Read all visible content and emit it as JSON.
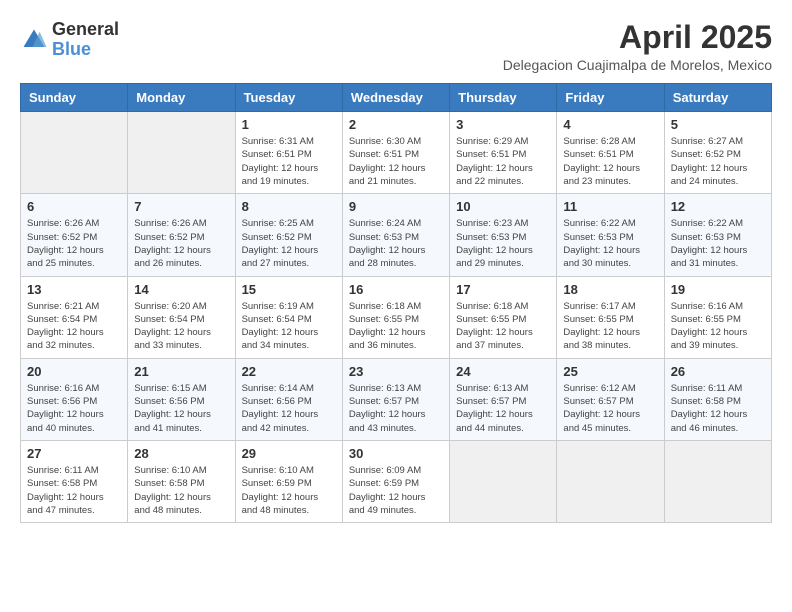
{
  "header": {
    "logo": {
      "general": "General",
      "blue": "Blue"
    },
    "title": "April 2025",
    "subtitle": "Delegacion Cuajimalpa de Morelos, Mexico"
  },
  "calendar": {
    "days_of_week": [
      "Sunday",
      "Monday",
      "Tuesday",
      "Wednesday",
      "Thursday",
      "Friday",
      "Saturday"
    ],
    "weeks": [
      [
        {
          "day": "",
          "info": ""
        },
        {
          "day": "",
          "info": ""
        },
        {
          "day": "1",
          "info": "Sunrise: 6:31 AM\nSunset: 6:51 PM\nDaylight: 12 hours and 19 minutes."
        },
        {
          "day": "2",
          "info": "Sunrise: 6:30 AM\nSunset: 6:51 PM\nDaylight: 12 hours and 21 minutes."
        },
        {
          "day": "3",
          "info": "Sunrise: 6:29 AM\nSunset: 6:51 PM\nDaylight: 12 hours and 22 minutes."
        },
        {
          "day": "4",
          "info": "Sunrise: 6:28 AM\nSunset: 6:51 PM\nDaylight: 12 hours and 23 minutes."
        },
        {
          "day": "5",
          "info": "Sunrise: 6:27 AM\nSunset: 6:52 PM\nDaylight: 12 hours and 24 minutes."
        }
      ],
      [
        {
          "day": "6",
          "info": "Sunrise: 6:26 AM\nSunset: 6:52 PM\nDaylight: 12 hours and 25 minutes."
        },
        {
          "day": "7",
          "info": "Sunrise: 6:26 AM\nSunset: 6:52 PM\nDaylight: 12 hours and 26 minutes."
        },
        {
          "day": "8",
          "info": "Sunrise: 6:25 AM\nSunset: 6:52 PM\nDaylight: 12 hours and 27 minutes."
        },
        {
          "day": "9",
          "info": "Sunrise: 6:24 AM\nSunset: 6:53 PM\nDaylight: 12 hours and 28 minutes."
        },
        {
          "day": "10",
          "info": "Sunrise: 6:23 AM\nSunset: 6:53 PM\nDaylight: 12 hours and 29 minutes."
        },
        {
          "day": "11",
          "info": "Sunrise: 6:22 AM\nSunset: 6:53 PM\nDaylight: 12 hours and 30 minutes."
        },
        {
          "day": "12",
          "info": "Sunrise: 6:22 AM\nSunset: 6:53 PM\nDaylight: 12 hours and 31 minutes."
        }
      ],
      [
        {
          "day": "13",
          "info": "Sunrise: 6:21 AM\nSunset: 6:54 PM\nDaylight: 12 hours and 32 minutes."
        },
        {
          "day": "14",
          "info": "Sunrise: 6:20 AM\nSunset: 6:54 PM\nDaylight: 12 hours and 33 minutes."
        },
        {
          "day": "15",
          "info": "Sunrise: 6:19 AM\nSunset: 6:54 PM\nDaylight: 12 hours and 34 minutes."
        },
        {
          "day": "16",
          "info": "Sunrise: 6:18 AM\nSunset: 6:55 PM\nDaylight: 12 hours and 36 minutes."
        },
        {
          "day": "17",
          "info": "Sunrise: 6:18 AM\nSunset: 6:55 PM\nDaylight: 12 hours and 37 minutes."
        },
        {
          "day": "18",
          "info": "Sunrise: 6:17 AM\nSunset: 6:55 PM\nDaylight: 12 hours and 38 minutes."
        },
        {
          "day": "19",
          "info": "Sunrise: 6:16 AM\nSunset: 6:55 PM\nDaylight: 12 hours and 39 minutes."
        }
      ],
      [
        {
          "day": "20",
          "info": "Sunrise: 6:16 AM\nSunset: 6:56 PM\nDaylight: 12 hours and 40 minutes."
        },
        {
          "day": "21",
          "info": "Sunrise: 6:15 AM\nSunset: 6:56 PM\nDaylight: 12 hours and 41 minutes."
        },
        {
          "day": "22",
          "info": "Sunrise: 6:14 AM\nSunset: 6:56 PM\nDaylight: 12 hours and 42 minutes."
        },
        {
          "day": "23",
          "info": "Sunrise: 6:13 AM\nSunset: 6:57 PM\nDaylight: 12 hours and 43 minutes."
        },
        {
          "day": "24",
          "info": "Sunrise: 6:13 AM\nSunset: 6:57 PM\nDaylight: 12 hours and 44 minutes."
        },
        {
          "day": "25",
          "info": "Sunrise: 6:12 AM\nSunset: 6:57 PM\nDaylight: 12 hours and 45 minutes."
        },
        {
          "day": "26",
          "info": "Sunrise: 6:11 AM\nSunset: 6:58 PM\nDaylight: 12 hours and 46 minutes."
        }
      ],
      [
        {
          "day": "27",
          "info": "Sunrise: 6:11 AM\nSunset: 6:58 PM\nDaylight: 12 hours and 47 minutes."
        },
        {
          "day": "28",
          "info": "Sunrise: 6:10 AM\nSunset: 6:58 PM\nDaylight: 12 hours and 48 minutes."
        },
        {
          "day": "29",
          "info": "Sunrise: 6:10 AM\nSunset: 6:59 PM\nDaylight: 12 hours and 48 minutes."
        },
        {
          "day": "30",
          "info": "Sunrise: 6:09 AM\nSunset: 6:59 PM\nDaylight: 12 hours and 49 minutes."
        },
        {
          "day": "",
          "info": ""
        },
        {
          "day": "",
          "info": ""
        },
        {
          "day": "",
          "info": ""
        }
      ]
    ]
  }
}
